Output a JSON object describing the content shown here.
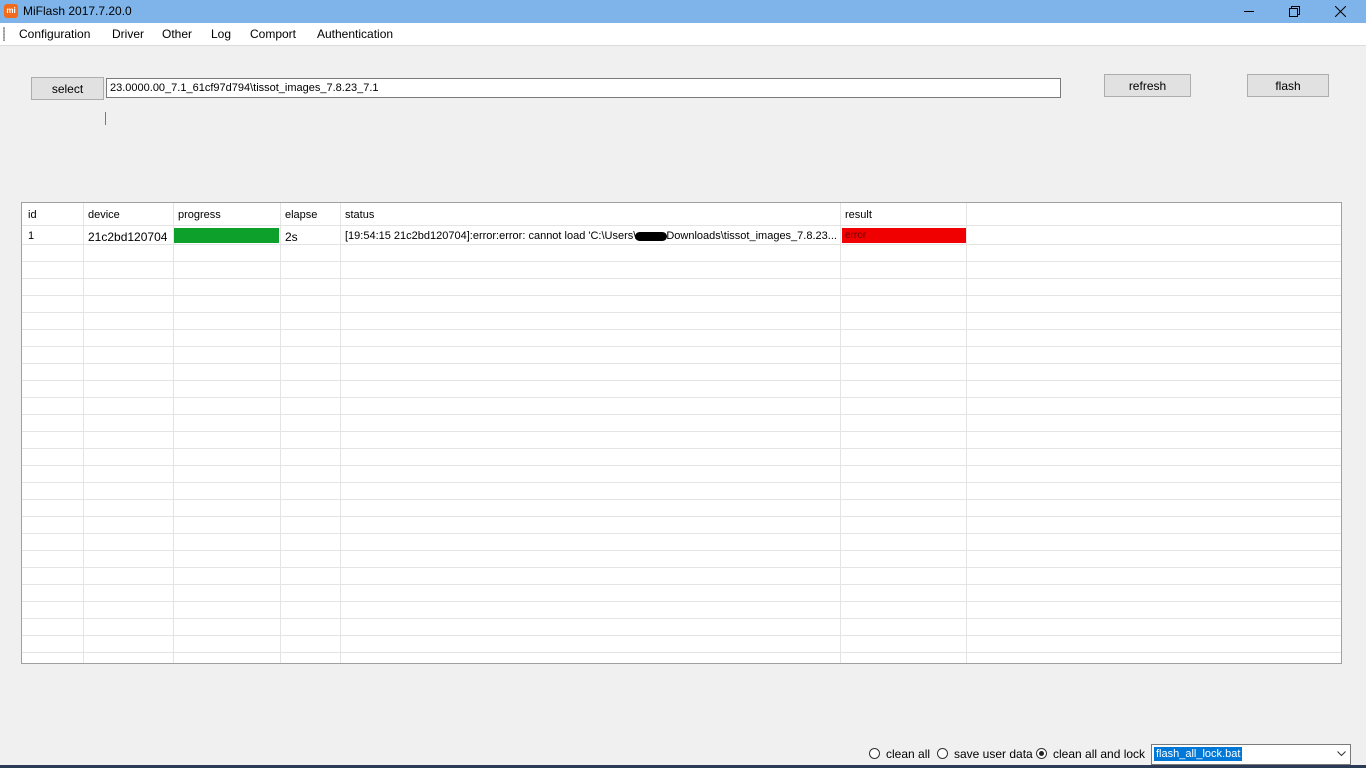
{
  "window": {
    "title": "MiFlash 2017.7.20.0",
    "icon_text": "mi",
    "controls": [
      "minimize-icon",
      "restore-icon",
      "close-icon"
    ]
  },
  "menu": {
    "items": [
      "Configuration",
      "Driver",
      "Other",
      "Log",
      "Comport",
      "Authentication"
    ]
  },
  "toolbar": {
    "select_label": "select",
    "path_value": "23.0000.00_7.1_61cf97d794\\tissot_images_7.8.23_7.1",
    "refresh_label": "refresh",
    "flash_label": "flash"
  },
  "grid": {
    "columns": [
      "id",
      "device",
      "progress",
      "elapse",
      "status",
      "result"
    ],
    "rows": [
      {
        "id": "1",
        "device": "21c2bd120704",
        "progress": 1.0,
        "elapse": "2s",
        "status_prefix": "[19:54:15  21c2bd120704]:error:error: cannot load 'C:\\Users\\",
        "status_suffix": "Downloads\\tissot_images_7.8.23...",
        "result": "error"
      }
    ],
    "colors": {
      "progress": "#0da02a",
      "result_error": "#f00000"
    }
  },
  "bottom": {
    "options": [
      {
        "label": "clean all",
        "checked": false
      },
      {
        "label": "save user data",
        "checked": false
      },
      {
        "label": "clean all and lock",
        "checked": true
      }
    ],
    "script_value": "flash_all_lock.bat"
  }
}
